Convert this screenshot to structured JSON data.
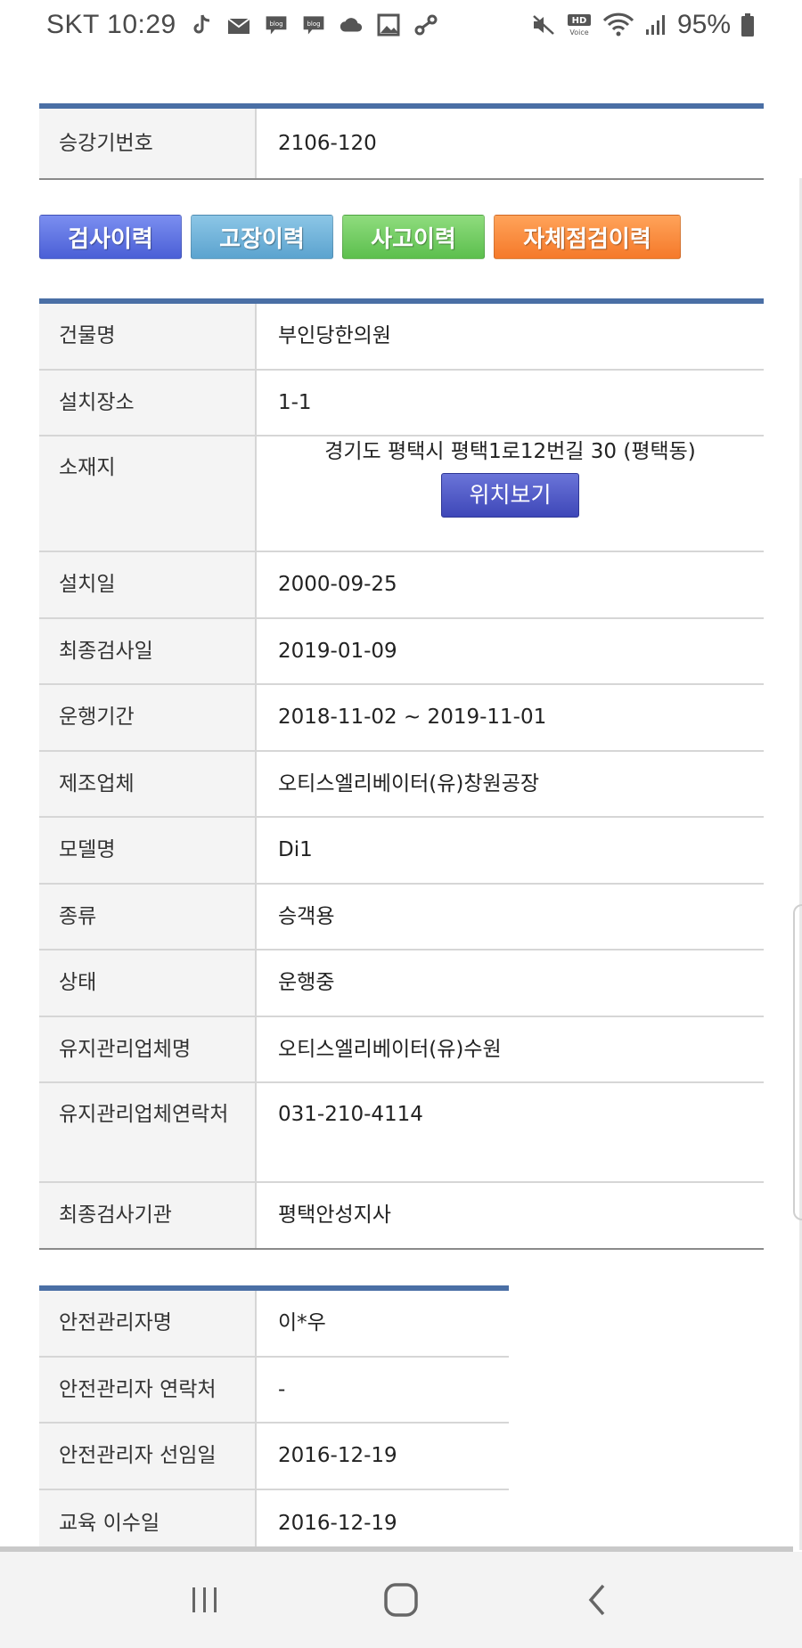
{
  "status_bar": {
    "carrier_time": "SKT 10:29",
    "battery_percent": "95%",
    "blog1": "blog",
    "blog2": "blog",
    "hd_label": "HD",
    "voice_label": "Voice"
  },
  "elevator_id": {
    "label": "승강기번호",
    "value": "2106-120"
  },
  "history_buttons": [
    {
      "label": "검사이력",
      "color": "#4a5fd6"
    },
    {
      "label": "고장이력",
      "color": "#5ba3cf"
    },
    {
      "label": "사고이력",
      "color": "#5cbf4d"
    },
    {
      "label": "자체점검이력",
      "color": "#f5792a"
    }
  ],
  "details": [
    {
      "label": "건물명",
      "value": "부인당한의원"
    },
    {
      "label": "설치장소",
      "value": "1-1"
    },
    {
      "label": "소재지",
      "value": "경기도 평택시 평택1로12번길 30 (평택동)",
      "button": "위치보기"
    },
    {
      "label": "설치일",
      "value": "2000-09-25"
    },
    {
      "label": "최종검사일",
      "value": "2019-01-09"
    },
    {
      "label": "운행기간",
      "value": "2018-11-02 ~ 2019-11-01"
    },
    {
      "label": "제조업체",
      "value": "오티스엘리베이터(유)창원공장"
    },
    {
      "label": "모델명",
      "value": "Di1"
    },
    {
      "label": "종류",
      "value": "승객용"
    },
    {
      "label": "상태",
      "value": "운행중"
    },
    {
      "label": "유지관리업체명",
      "value": "오티스엘리베이터(유)수원"
    },
    {
      "label": "유지관리업체연락처",
      "value": "031-210-4114"
    },
    {
      "label": "최종검사기관",
      "value": "평택안성지사"
    }
  ],
  "safety": [
    {
      "label": "안전관리자명",
      "value": "이*우"
    },
    {
      "label": "안전관리자 연락처",
      "value": "-"
    },
    {
      "label": "안전관리자 선임일",
      "value": "2016-12-19"
    },
    {
      "label": "교육 이수일",
      "value": "2016-12-19"
    }
  ],
  "colors": {
    "table_top_border": "#4a6fa5",
    "header_cell_bg": "#f4f4f4"
  }
}
